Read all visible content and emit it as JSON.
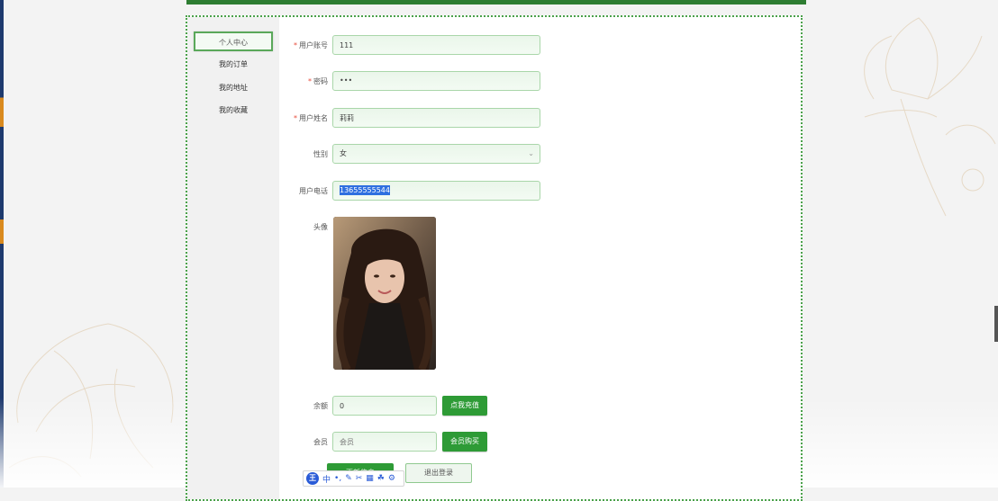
{
  "sidebar": {
    "items": [
      {
        "label": "个人中心",
        "active": true
      },
      {
        "label": "我的订单",
        "active": false
      },
      {
        "label": "我的地址",
        "active": false
      },
      {
        "label": "我的收藏",
        "active": false
      }
    ]
  },
  "form": {
    "account": {
      "label": "用户账号",
      "required": true,
      "value": "111"
    },
    "password": {
      "label": "密码",
      "required": true,
      "value": "•••"
    },
    "name": {
      "label": "用户姓名",
      "required": true,
      "value": "莉莉"
    },
    "gender": {
      "label": "性别",
      "value": "女"
    },
    "phone": {
      "label": "用户电话",
      "value": "13655555544"
    },
    "avatar": {
      "label": "头像"
    },
    "balance": {
      "label": "余额",
      "value": "0",
      "button": "点我充值"
    },
    "member": {
      "label": "会员",
      "placeholder": "会员",
      "button": "会员购买"
    },
    "actions": {
      "update": "更新信息",
      "logout": "退出登录"
    }
  },
  "ime": {
    "logo": "王",
    "mode": "中"
  },
  "colors": {
    "accent": "#2e9b36",
    "selection": "#2f6fe0",
    "border": "#4aa14a"
  }
}
